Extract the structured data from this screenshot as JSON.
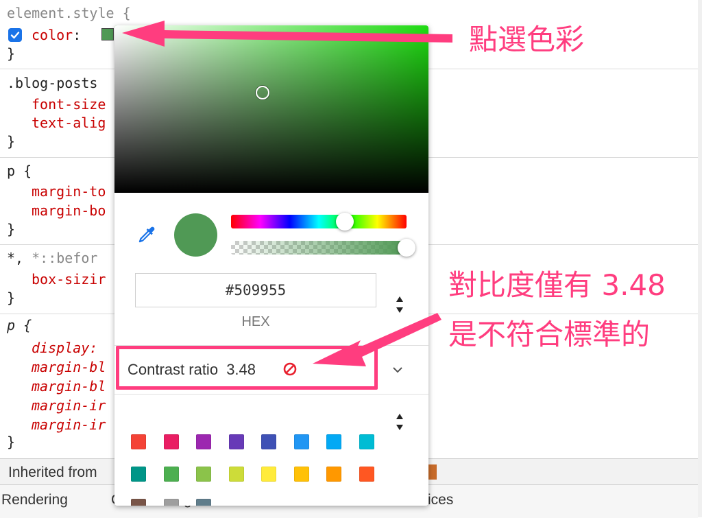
{
  "styles": {
    "rules": [
      {
        "selector": "element.style {",
        "props": [
          {
            "name": "color",
            "value": ":"
          }
        ],
        "close": "}"
      },
      {
        "selector": ".blog-posts",
        "props": [
          {
            "name": "font-size"
          },
          {
            "name": "text-alig"
          }
        ],
        "close": "}"
      },
      {
        "selector": "p {",
        "props": [
          {
            "name": "margin-to"
          },
          {
            "name": "margin-bo"
          }
        ],
        "close": "}"
      },
      {
        "selector_a": "*, ",
        "selector_b": "*::befor",
        "props": [
          {
            "name": "box-sizir"
          }
        ],
        "close": "}"
      },
      {
        "selector": "p {",
        "props": [
          {
            "name": "display:"
          },
          {
            "name": "margin-bl"
          },
          {
            "name": "margin-bl"
          },
          {
            "name": "margin-ir"
          },
          {
            "name": "margin-ir"
          }
        ],
        "close": "}"
      }
    ],
    "inherited_label": "Inherited from"
  },
  "bottom_tabs": [
    "Rendering",
    "C",
    "g",
    "ices"
  ],
  "color_picker": {
    "hex_value": "#509955",
    "format_label": "HEX",
    "contrast_label": "Contrast ratio",
    "contrast_value": "3.48",
    "current_color": "#509955",
    "hue_color": "#1fdc12",
    "hue_position": 0.65,
    "alpha": 1.0,
    "palette": [
      "#f44336",
      "#e91e63",
      "#9c27b0",
      "#673ab7",
      "#3f51b5",
      "#2196f3",
      "#03a9f4",
      "#00bcd4",
      "#009688",
      "#4caf50",
      "#8bc34a",
      "#cddc39",
      "#ffeb3b",
      "#ffc107",
      "#ff9800",
      "#ff5722",
      "#795548",
      "#9e9e9e",
      "#607d8b"
    ]
  },
  "annotations": {
    "pick_color": "點選色彩",
    "contrast_line1": "對比度僅有 3.48",
    "contrast_line2": "是不符合標準的",
    "accent_color": "#ff3d7f"
  },
  "icons": {
    "eyedropper": "eyedropper-icon",
    "no_entry": "no-entry-icon",
    "chevron": "chevron-down-icon",
    "up_down": "up-down-arrows-icon",
    "checkbox": "checkbox-checked-icon"
  }
}
